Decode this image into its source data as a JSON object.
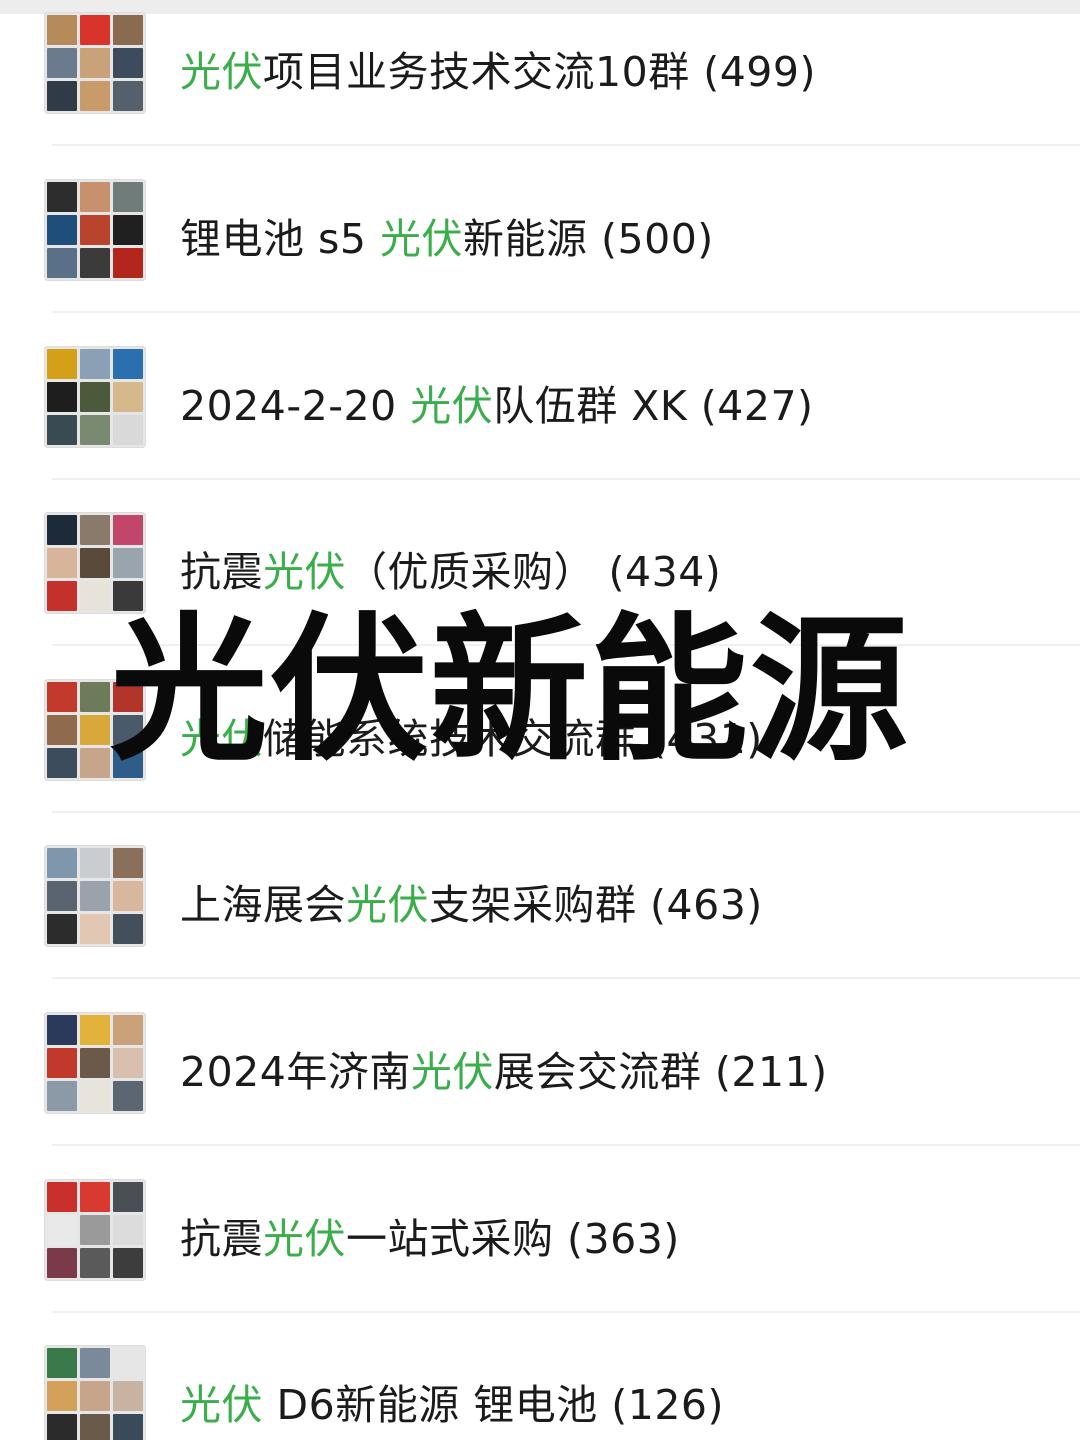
{
  "groups": [
    {
      "prefix": "",
      "highlight": "光伏",
      "suffix": "项目业务技术交流10群 (499)",
      "tiles": [
        "#b58b5a",
        "#d9342b",
        "#8a6b4f",
        "#6b7a8c",
        "#c9a27a",
        "#3d4b5c",
        "#2f3b47",
        "#c99b6a",
        "#54606c"
      ]
    },
    {
      "prefix": "锂电池 s5 ",
      "highlight": "光伏",
      "suffix": "新能源 (500)",
      "tiles": [
        "#2d2d2d",
        "#c7916e",
        "#6f7c7a",
        "#1f4e7a",
        "#b9442e",
        "#202020",
        "#5a6f88",
        "#3b3b3b",
        "#b3261e"
      ]
    },
    {
      "prefix": "2024-2-20 ",
      "highlight": "光伏",
      "suffix": "队伍群 XK (427)",
      "tiles": [
        "#d4a017",
        "#8aa0b5",
        "#2a6fb0",
        "#1e1e1e",
        "#4a5a3a",
        "#d6b98a",
        "#3a4a52",
        "#7a8a70",
        "#d9d9d9"
      ]
    },
    {
      "prefix": "抗震",
      "highlight": "光伏",
      "suffix": "（优质采购） (434)",
      "tiles": [
        "#1c2a3a",
        "#8a7a6a",
        "#c1466a",
        "#d7b49a",
        "#5a4a3a",
        "#9aa4ae",
        "#c4302b",
        "#e7e2da",
        "#3a3a3a"
      ]
    },
    {
      "prefix": "",
      "highlight": "光伏",
      "suffix": "储能系统技术交流群 (431)",
      "tiles": [
        "#c23a2b",
        "#6e7b5a",
        "#b2342a",
        "#8f6a4d",
        "#d8a83a",
        "#4b5a6a",
        "#3c4c5c",
        "#c7a58a",
        "#2f5d8a"
      ]
    },
    {
      "prefix": "上海展会",
      "highlight": "光伏",
      "suffix": "支架采购群 (463)",
      "tiles": [
        "#7f97ad",
        "#c9ccd0",
        "#8a6f5a",
        "#5a6470",
        "#9aa3ab",
        "#d8b79d",
        "#2c2c2c",
        "#e2c7b2",
        "#43505c"
      ]
    },
    {
      "prefix": "2024年济南",
      "highlight": "光伏",
      "suffix": "展会交流群 (211)",
      "tiles": [
        "#2a3a5a",
        "#e2b23a",
        "#c9a27a",
        "#c0392b",
        "#6b5a4a",
        "#d8bfae",
        "#8b9aa6",
        "#e8e4dc",
        "#5c6672"
      ]
    },
    {
      "prefix": "抗震",
      "highlight": "光伏",
      "suffix": "一站式采购 (363)",
      "tiles": [
        "#c9302c",
        "#d93a30",
        "#4a4f55",
        "#e9e9e9",
        "#9a9a9a",
        "#dcdcdc",
        "#7a3a4a",
        "#5a5a5a",
        "#3d3d3d"
      ]
    },
    {
      "prefix": "",
      "highlight": "光伏",
      "suffix": " D6新能源 锂电池 (126)",
      "tiles": [
        "#3a7a4a",
        "#7a8a9a",
        "#e6e6e6",
        "#d4a15a",
        "#c7a58a",
        "#c8b3a2",
        "#2b2b2b",
        "#6a5a4a",
        "#3a4a5a"
      ]
    }
  ],
  "overlay_text": "光伏新能源"
}
